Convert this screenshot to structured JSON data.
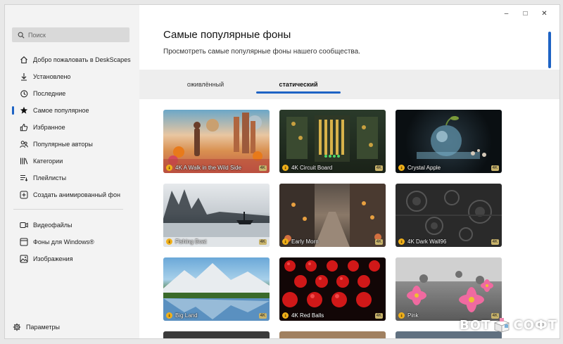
{
  "window": {
    "title": "Самые популярные фоны",
    "subtitle": "Просмотреть самые популярные фоны нашего сообщества.",
    "controls": {
      "minimize": "–",
      "maximize": "□",
      "close": "✕"
    }
  },
  "search": {
    "placeholder": "Поиск",
    "icon": "search-icon"
  },
  "sidebar": {
    "items": [
      {
        "label": "Добро пожаловать в DeskScapes",
        "icon": "home-icon"
      },
      {
        "label": "Установлено",
        "icon": "download-icon"
      },
      {
        "label": "Последние",
        "icon": "history-icon"
      },
      {
        "label": "Самое популярное",
        "icon": "star-icon",
        "active": true
      },
      {
        "label": "Избранное",
        "icon": "thumbs-up-icon"
      },
      {
        "label": "Популярные авторы",
        "icon": "people-icon"
      },
      {
        "label": "Категории",
        "icon": "library-icon"
      },
      {
        "label": "Плейлисты",
        "icon": "playlist-icon"
      },
      {
        "label": "Создать анимированный фон",
        "icon": "add-icon"
      }
    ],
    "items2": [
      {
        "label": "Видеофайлы",
        "icon": "video-icon"
      },
      {
        "label": "Фоны для Windows®",
        "icon": "windows-icon"
      },
      {
        "label": "Изображения",
        "icon": "image-icon"
      }
    ],
    "settings": {
      "label": "Параметры",
      "icon": "gear-icon"
    }
  },
  "tabs": [
    {
      "label": "оживлённый",
      "active": false
    },
    {
      "label": "статический",
      "active": true
    }
  ],
  "accent_color": "#1e63c4",
  "cards": [
    {
      "title": "4K A Walk in the Wild Side",
      "badge": "4K"
    },
    {
      "title": "4K Circuit Board",
      "badge": "4K"
    },
    {
      "title": "Crystal Apple",
      "badge": "4K"
    },
    {
      "title": "Fishing Boat",
      "badge": "4K"
    },
    {
      "title": "Early Morn",
      "badge": "4K"
    },
    {
      "title": "4K Dark Wall96",
      "badge": "4K"
    },
    {
      "title": "Big Land",
      "badge": "4K"
    },
    {
      "title": "4K Red Balls",
      "badge": "4K"
    },
    {
      "title": "Pink",
      "badge": "4K"
    }
  ],
  "watermark": {
    "left": "ВОТ",
    "right": "СОФТ"
  }
}
